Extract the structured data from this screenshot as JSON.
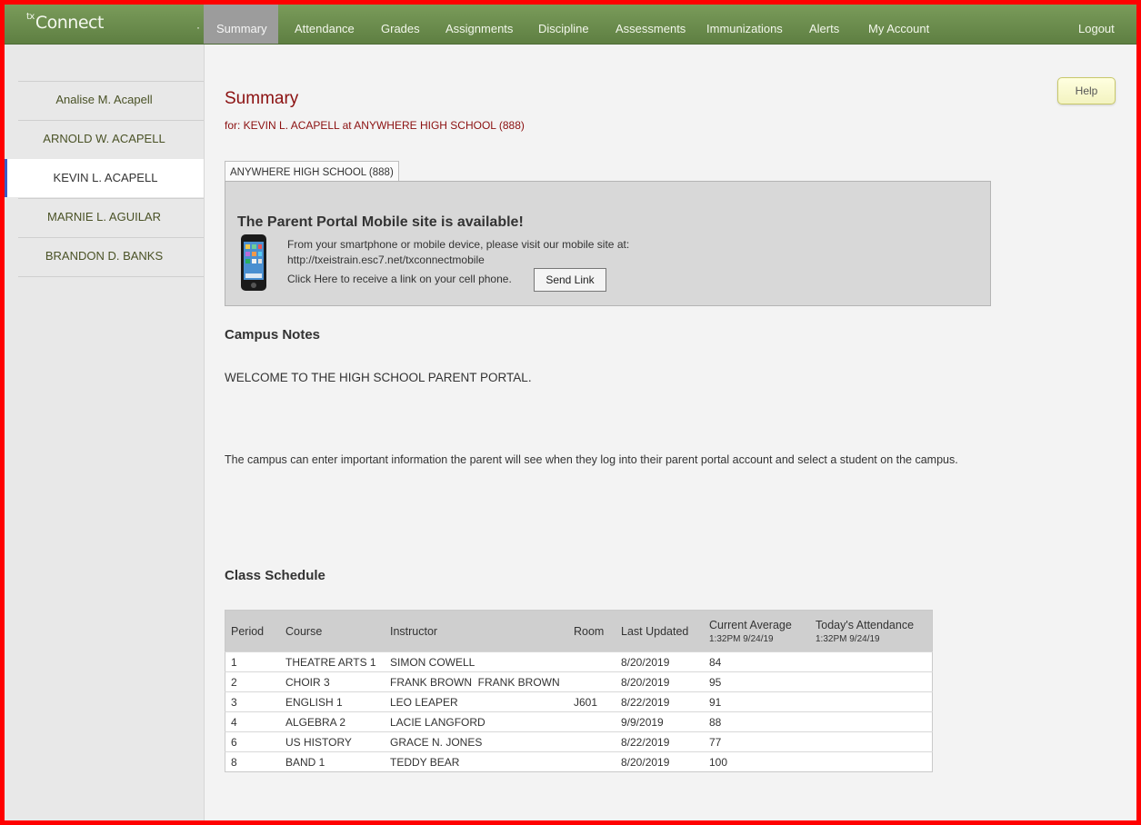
{
  "app": {
    "logo_prefix": "tx",
    "logo": "Connect"
  },
  "nav": {
    "tabs": [
      {
        "label": "Summary",
        "active": true
      },
      {
        "label": "Attendance"
      },
      {
        "label": "Grades"
      },
      {
        "label": "Assignments"
      },
      {
        "label": "Discipline"
      },
      {
        "label": "Assessments"
      },
      {
        "label": "Immunizations"
      },
      {
        "label": "Alerts"
      },
      {
        "label": "My Account"
      }
    ],
    "logout": "Logout"
  },
  "sidebar": {
    "students": [
      {
        "name": "Analise M. Acapell"
      },
      {
        "name": "ARNOLD W. ACAPELL"
      },
      {
        "name": "KEVIN L. ACAPELL",
        "active": true
      },
      {
        "name": "MARNIE L. AGUILAR"
      },
      {
        "name": "BRANDON D. BANKS"
      }
    ]
  },
  "page": {
    "title": "Summary",
    "subtitle": "for: KEVIN L. ACAPELL at ANYWHERE HIGH SCHOOL (888)",
    "help": "Help",
    "campus_tab": "ANYWHERE HIGH SCHOOL (888)"
  },
  "mobile": {
    "title": "The Parent Portal Mobile site is available!",
    "line1": "From your smartphone or mobile device, please visit our mobile site at:",
    "url": "http://txeistrain.esc7.net/txconnectmobile",
    "line3": "Click Here to receive a link on your cell phone.",
    "send_button": "Send Link"
  },
  "campus_notes": {
    "heading": "Campus Notes",
    "welcome": "WELCOME TO THE HIGH SCHOOL PARENT PORTAL.",
    "info": "The campus can enter important information the parent will see when they log into their parent portal account and select a student on the campus."
  },
  "schedule": {
    "heading": "Class Schedule",
    "columns": {
      "period": "Period",
      "course": "Course",
      "instructor": "Instructor",
      "room": "Room",
      "last_updated": "Last Updated",
      "current_average": "Current Average",
      "current_average_time": "1:32PM 9/24/19",
      "todays_attendance": "Today's Attendance",
      "todays_attendance_time": "1:32PM 9/24/19"
    },
    "rows": [
      {
        "period": "1",
        "course": "THEATRE ARTS 1",
        "instructor": "SIMON COWELL",
        "room": "",
        "updated": "8/20/2019",
        "average": "84",
        "attendance": ""
      },
      {
        "period": "2",
        "course": "CHOIR 3",
        "instructor": "FRANK BROWN  FRANK BROWN",
        "room": "",
        "updated": "8/20/2019",
        "average": "95",
        "attendance": ""
      },
      {
        "period": "3",
        "course": "ENGLISH 1",
        "instructor": "LEO LEAPER",
        "room": "J601",
        "updated": "8/22/2019",
        "average": "91",
        "attendance": ""
      },
      {
        "period": "4",
        "course": "ALGEBRA 2",
        "instructor": "LACIE LANGFORD",
        "room": "",
        "updated": "9/9/2019",
        "average": "88",
        "attendance": ""
      },
      {
        "period": "6",
        "course": "US HISTORY",
        "instructor": "GRACE N. JONES",
        "room": "",
        "updated": "8/22/2019",
        "average": "77",
        "attendance": ""
      },
      {
        "period": "8",
        "course": "BAND 1",
        "instructor": "TEDDY BEAR",
        "room": "",
        "updated": "8/20/2019",
        "average": "100",
        "attendance": ""
      }
    ]
  }
}
